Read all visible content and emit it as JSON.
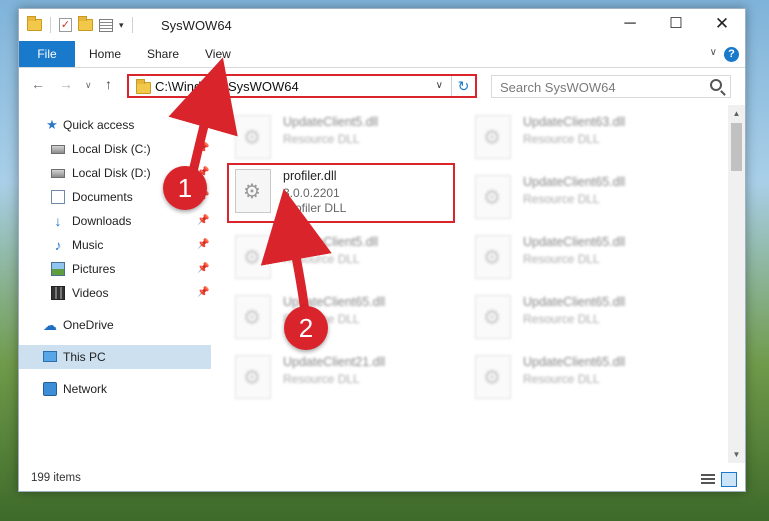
{
  "window": {
    "title": "SysWOW64",
    "controls": {
      "minimize": "─",
      "maximize": "☐",
      "close": "✕"
    }
  },
  "ribbon": {
    "tabs": [
      "File",
      "Home",
      "Share",
      "View"
    ],
    "help": "?"
  },
  "address": {
    "path": "C:\\Windows\\SysWOW64",
    "refresh": "↻",
    "dropdown": "∨"
  },
  "search": {
    "placeholder": "Search SysWOW64"
  },
  "navigation": {
    "back": "←",
    "forward": "→",
    "recent": "∨",
    "up": "↑"
  },
  "sidebar": {
    "items": [
      {
        "label": "Quick access",
        "icon": "star-icon"
      },
      {
        "label": "Local Disk (C:)",
        "icon": "drive-icon",
        "pinned": true
      },
      {
        "label": "Local Disk (D:)",
        "icon": "drive-icon",
        "pinned": true
      },
      {
        "label": "Documents",
        "icon": "documents-icon",
        "pinned": true
      },
      {
        "label": "Downloads",
        "icon": "downloads-icon",
        "pinned": true
      },
      {
        "label": "Music",
        "icon": "music-icon",
        "pinned": true
      },
      {
        "label": "Pictures",
        "icon": "pictures-icon",
        "pinned": true
      },
      {
        "label": "Videos",
        "icon": "videos-icon",
        "pinned": true
      },
      {
        "label": "OneDrive",
        "icon": "onedrive-icon"
      },
      {
        "label": "This PC",
        "icon": "computer-icon",
        "selected": true
      },
      {
        "label": "Network",
        "icon": "network-icon"
      }
    ]
  },
  "files": {
    "highlighted": {
      "name": "profiler.dll",
      "version": "3.0.0.2201",
      "description": "Profiler DLL"
    },
    "background": [
      {
        "name": "UpdateClient5.dll",
        "description": "Resource DLL"
      },
      {
        "name": "UpdateClient63.dll",
        "description": "Resource DLL"
      },
      {
        "name": "UpdateClient65.dll",
        "description": "Resource DLL"
      },
      {
        "name": "UpdateClient5.dll",
        "description": "Resource DLL"
      },
      {
        "name": "UpdateClient65.dll",
        "description": "Resource DLL"
      },
      {
        "name": "UpdateClient65.dll",
        "description": "Resource DLL"
      },
      {
        "name": "UpdateClient65.dll",
        "description": "Resource DLL"
      },
      {
        "name": "UpdateClient21.dll",
        "description": "Resource DLL"
      },
      {
        "name": "UpdateClient65.dll",
        "description": "Resource DLL"
      }
    ]
  },
  "status": {
    "item_count": "199 items"
  },
  "callouts": [
    "1",
    "2"
  ],
  "colors": {
    "accent": "#1979ca",
    "highlight": "#d9242b",
    "selected": "#cce0f0"
  }
}
